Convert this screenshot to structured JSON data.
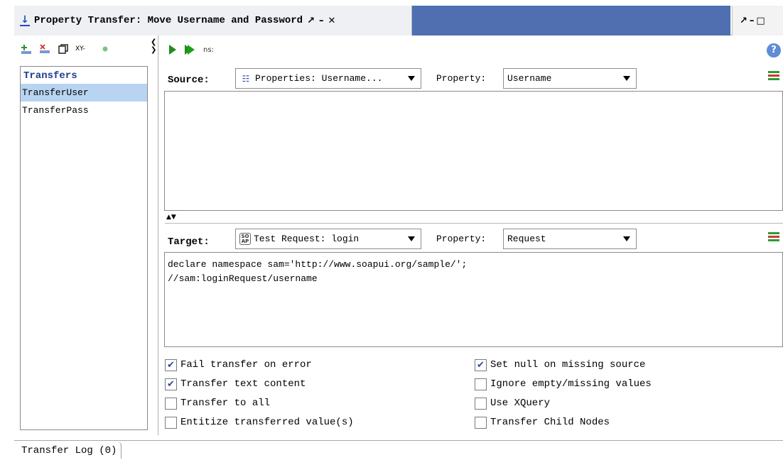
{
  "window": {
    "title": "Property Transfer: Move Username and Password",
    "tab_controls": [
      "↗",
      "–",
      "✕"
    ],
    "right_controls": [
      "↗",
      "–",
      "□"
    ]
  },
  "left_panel": {
    "toolbar": {
      "xy_label": "XY-"
    },
    "list_title": "Transfers",
    "items": [
      {
        "label": "TransferUser",
        "selected": true
      },
      {
        "label": "TransferPass",
        "selected": false
      }
    ]
  },
  "toolbar": {
    "ns_label": "ns:"
  },
  "source": {
    "label": "Source:",
    "step_value": "Properties: Username...",
    "property_label": "Property:",
    "property_value": "Username",
    "expression": ""
  },
  "target": {
    "label": "Target:",
    "step_value": "Test Request: login",
    "property_label": "Property:",
    "property_value": "Request",
    "expression": "declare namespace sam='http://www.soapui.org/sample/';\n//sam:loginRequest/username"
  },
  "options": {
    "left": [
      {
        "label": "Fail transfer on error",
        "checked": true
      },
      {
        "label": "Transfer text content",
        "checked": true
      },
      {
        "label": "Transfer to all",
        "checked": false
      },
      {
        "label": "Entitize transferred value(s)",
        "checked": false
      }
    ],
    "right": [
      {
        "label": "Set null on missing source",
        "checked": true
      },
      {
        "label": "Ignore empty/missing values",
        "checked": false
      },
      {
        "label": "Use XQuery",
        "checked": false
      },
      {
        "label": "Transfer Child Nodes",
        "checked": false
      }
    ]
  },
  "log": {
    "tab_label": "Transfer Log (0)"
  },
  "colors": {
    "accent": "#4f6fb0",
    "selection": "#b8d4f1",
    "run": "#1e8f1e"
  }
}
